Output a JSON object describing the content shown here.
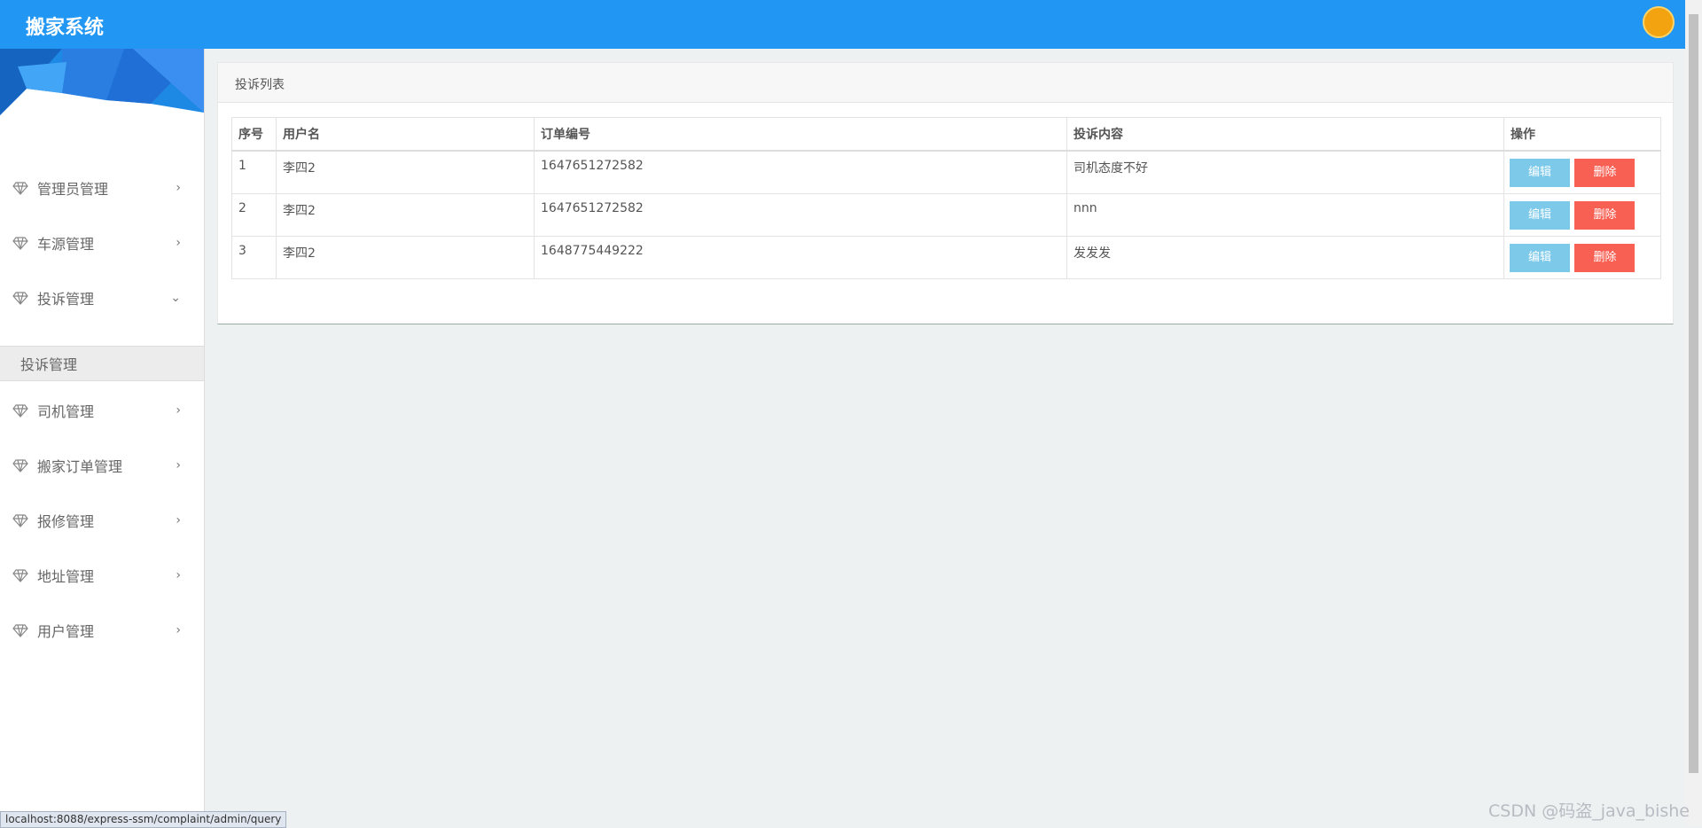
{
  "app": {
    "title": "搬家系统"
  },
  "sidebar": {
    "items": [
      {
        "label": "管理员管理",
        "chevron": "›"
      },
      {
        "label": "车源管理",
        "chevron": "›"
      },
      {
        "label": "投诉管理",
        "chevron": "⌄"
      },
      {
        "label": "司机管理",
        "chevron": "›"
      },
      {
        "label": "搬家订单管理",
        "chevron": "›"
      },
      {
        "label": "报修管理",
        "chevron": "›"
      },
      {
        "label": "地址管理",
        "chevron": "›"
      },
      {
        "label": "用户管理",
        "chevron": "›"
      }
    ],
    "active_sub": "投诉管理"
  },
  "panel": {
    "title": "投诉列表"
  },
  "table": {
    "headers": [
      "序号",
      "用户名",
      "订单编号",
      "投诉内容",
      "操作"
    ],
    "rows": [
      {
        "no": "1",
        "user": "李四2",
        "order": "1647651272582",
        "content": "司机态度不好"
      },
      {
        "no": "2",
        "user": "李四2",
        "order": "1647651272582",
        "content": "nnn"
      },
      {
        "no": "3",
        "user": "李四2",
        "order": "1648775449222",
        "content": "发发发"
      }
    ],
    "edit_label": "编辑",
    "delete_label": "删除"
  },
  "status": {
    "url": "localhost:8088/express-ssm/complaint/admin/query"
  },
  "watermark": "CSDN @码盗_java_bishe",
  "colors": {
    "topbar": "#2196f3",
    "edit": "#7dc9ea",
    "delete": "#f86053"
  }
}
